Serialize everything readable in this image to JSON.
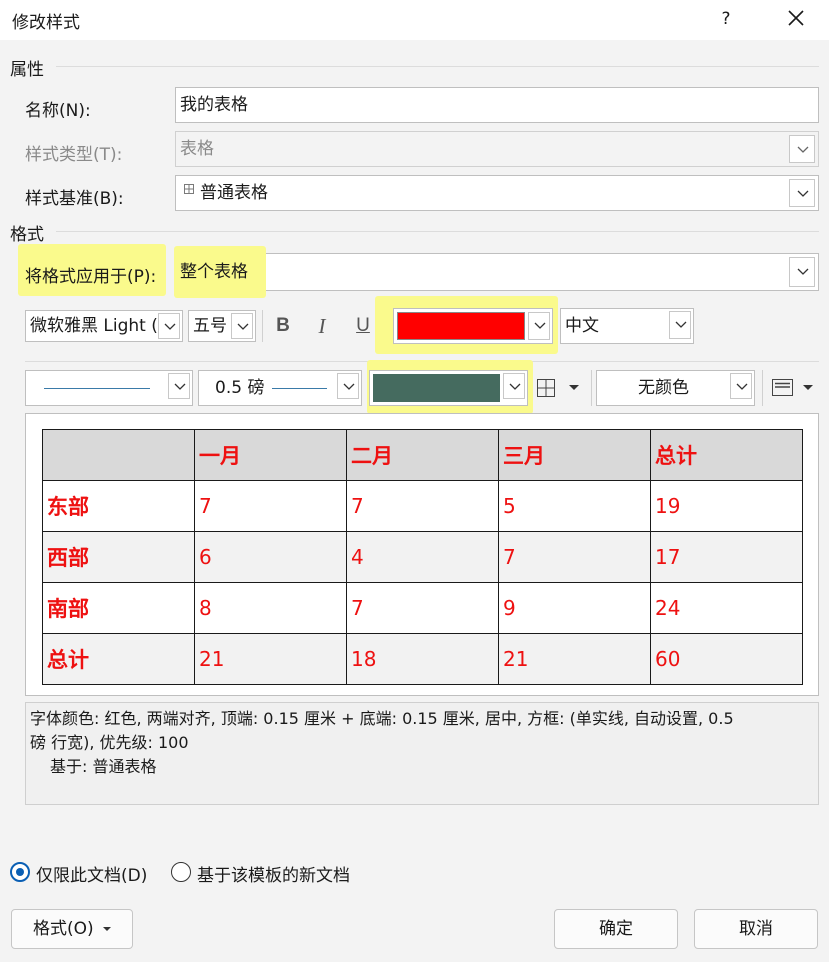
{
  "dialog": {
    "title": "修改样式",
    "help_label": "?"
  },
  "properties": {
    "section_label": "属性",
    "name_label": "名称(N):",
    "name_value": "我的表格",
    "style_type_label": "样式类型(T):",
    "style_type_value": "表格",
    "based_on_label": "样式基准(B):",
    "based_on_value": "普通表格"
  },
  "format": {
    "section_label": "格式",
    "apply_to_label": "将格式应用于(P):",
    "apply_to_value": "整个表格",
    "font_name": "微软雅黑 Light (",
    "font_size": "五号",
    "bold_label": "B",
    "italic_label": "I",
    "underline_label": "U",
    "font_color": "#ff0000",
    "language": "中文",
    "border_style": "single-line",
    "border_width": "0.5 磅",
    "border_color": "#456b5f",
    "shading": "无颜色",
    "icons": [
      "grid-border-icon",
      "table-style-icon",
      "chevron-down-icon",
      "close-icon"
    ]
  },
  "preview": {
    "header": [
      "",
      "一月",
      "二月",
      "三月",
      "总计"
    ],
    "rows": [
      [
        "东部",
        "7",
        "7",
        "5",
        "19"
      ],
      [
        "西部",
        "6",
        "4",
        "7",
        "17"
      ],
      [
        "南部",
        "8",
        "7",
        "9",
        "24"
      ],
      [
        "总计",
        "21",
        "18",
        "21",
        "60"
      ]
    ],
    "text_color": "#ee1111",
    "header_fill": "#d9d9d9",
    "alt_row_fill": "#f2f2f2"
  },
  "description": {
    "line1": "字体颜色: 红色, 两端对齐, 顶端:  0.15 厘米 + 底端:  0.15 厘米, 居中, 方框: (单实线, 自动设置,  0.5",
    "line2": "磅 行宽), 优先级: 100",
    "line3": "基于: 普通表格"
  },
  "scope": {
    "this_doc_label": "仅限此文档(D)",
    "template_label": "基于该模板的新文档",
    "selected": "this_doc"
  },
  "buttons": {
    "format_label": "格式(O)",
    "ok_label": "确定",
    "cancel_label": "取消"
  }
}
